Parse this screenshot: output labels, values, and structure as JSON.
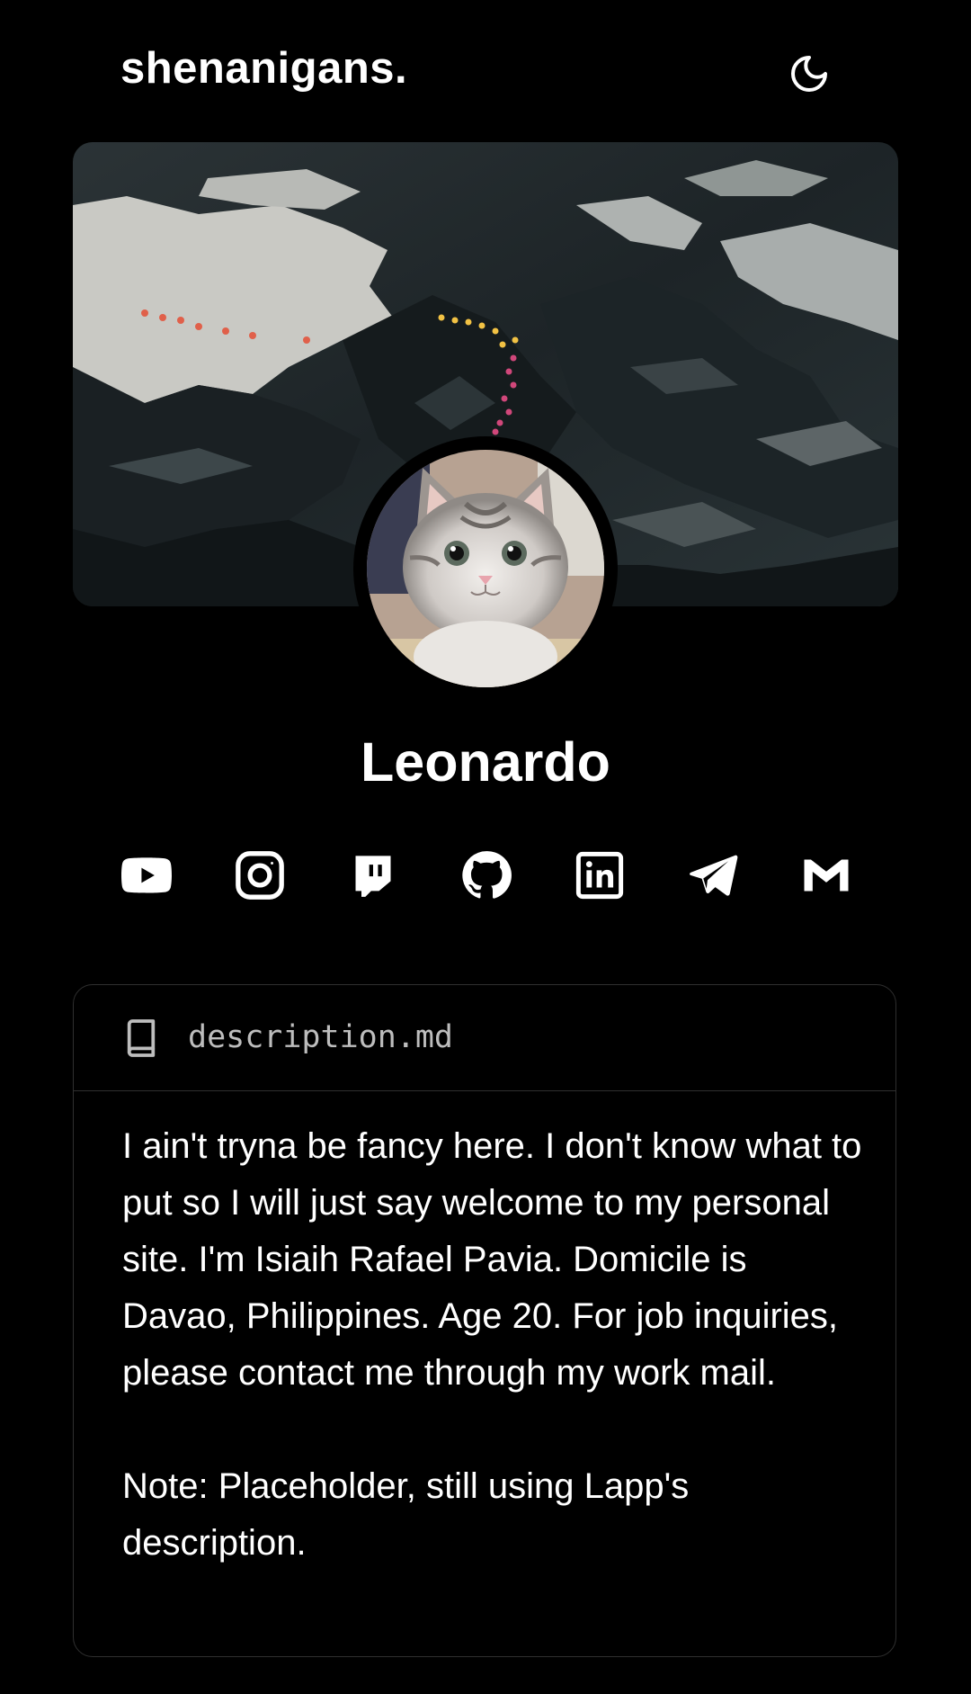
{
  "header": {
    "site_title": "shenanigans.",
    "theme_toggle_icon": "moon-icon"
  },
  "profile": {
    "banner": "mountain-hikers-banner",
    "avatar": "cat-avatar",
    "name": "Leonardo"
  },
  "socials": [
    {
      "name": "YouTube",
      "icon": "youtube-icon"
    },
    {
      "name": "Instagram",
      "icon": "instagram-icon"
    },
    {
      "name": "Twitch",
      "icon": "twitch-icon"
    },
    {
      "name": "GitHub",
      "icon": "github-icon"
    },
    {
      "name": "LinkedIn",
      "icon": "linkedin-icon"
    },
    {
      "name": "Telegram",
      "icon": "telegram-icon"
    },
    {
      "name": "Gmail",
      "icon": "gmail-icon"
    }
  ],
  "description_card": {
    "icon": "book-icon",
    "filename": "description.md",
    "paragraph_1": "I ain't tryna be fancy here. I don't know what to put so I will just say welcome to my personal site. I'm Isiaih Rafael Pavia. Domicile is Davao, Philippines. Age 20. For job inquiries, please contact me through my work mail.",
    "paragraph_2": "Note: Placeholder, still using Lapp's description."
  },
  "colors": {
    "background": "#000000",
    "text": "#ffffff",
    "muted_text": "#bdbdbd",
    "card_border": "#2f2f2f"
  }
}
